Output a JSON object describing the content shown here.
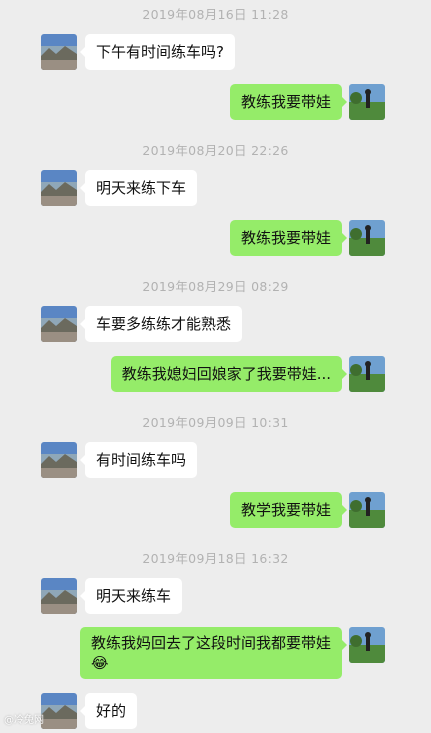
{
  "messages": [
    {
      "timestamp": "2019年08月16日 11:28",
      "incoming": "下午有时间练车吗?",
      "outgoing": "教练我要带娃"
    },
    {
      "timestamp": "2019年08月20日 22:26",
      "incoming": "明天来练下车",
      "outgoing": "教练我要带娃"
    },
    {
      "timestamp": "2019年08月29日 08:29",
      "incoming": "车要多练练才能熟悉",
      "outgoing": "教练我媳妇回娘家了我要带娃..."
    },
    {
      "timestamp": "2019年09月09日 10:31",
      "incoming": "有时间练车吗",
      "outgoing": "教学我要带娃"
    },
    {
      "timestamp": "2019年09月18日 16:32",
      "incoming": "明天来练车",
      "outgoing": "教练我妈回去了这段时间我都要带娃",
      "outgoing_emoji": "😂"
    }
  ],
  "last_incoming": "好的",
  "watermark": "@冷兔网",
  "colors": {
    "background": "#ededed",
    "incoming_bubble": "#ffffff",
    "outgoing_bubble": "#95ec69",
    "timestamp_text": "#b2b2b2"
  },
  "icons": {
    "incoming_avatar": "mountain-lake-avatar",
    "outgoing_avatar": "field-person-avatar"
  }
}
